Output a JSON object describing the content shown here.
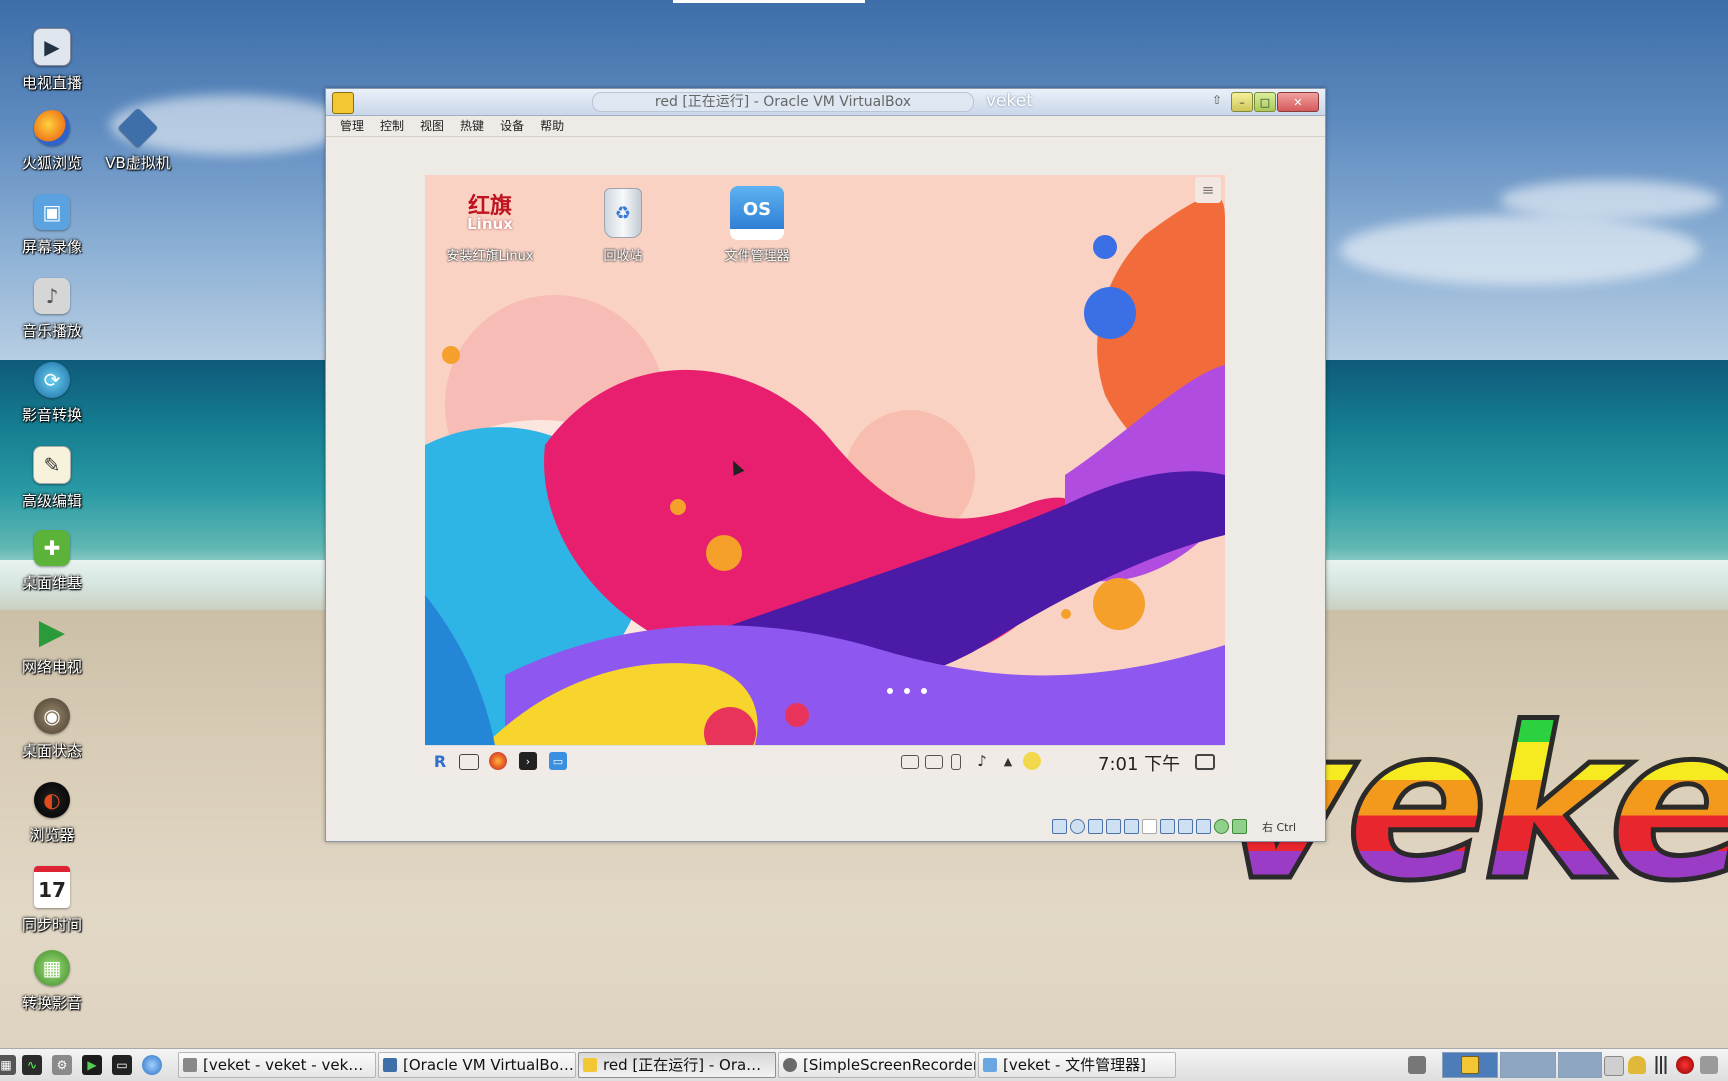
{
  "desktop": {
    "icons": [
      {
        "label": "电视直播",
        "icon": "tv-icon"
      },
      {
        "label": "火狐浏览",
        "icon": "firefox-icon"
      },
      {
        "label": "VB虚拟机",
        "icon": "virtualbox-icon"
      },
      {
        "label": "屏幕录像",
        "icon": "screen-record-icon"
      },
      {
        "label": "音乐播放",
        "icon": "speaker-icon"
      },
      {
        "label": "影音转换",
        "icon": "media-convert-icon"
      },
      {
        "label": "高级编辑",
        "icon": "notepad-icon"
      },
      {
        "label": "桌面维基",
        "icon": "wiki-icon"
      },
      {
        "label": "网络电视",
        "icon": "play-icon"
      },
      {
        "label": "桌面状态",
        "icon": "status-icon"
      },
      {
        "label": "浏览器",
        "icon": "browser-icon"
      },
      {
        "label": "同步时间",
        "icon": "calendar-icon",
        "badge": "17"
      },
      {
        "label": "转换影音",
        "icon": "film-convert-icon"
      }
    ],
    "logo_text": "veket"
  },
  "vbox": {
    "title": "red [正在运行] - Oracle VM VirtualBox",
    "wm_name": "veket",
    "menu": [
      "管理",
      "控制",
      "视图",
      "热键",
      "设备",
      "帮助"
    ],
    "host_key": "右 Ctrl"
  },
  "guest": {
    "icons": [
      {
        "label": "安装红旗Linux",
        "logo_top": "红旗",
        "logo_bottom": "Linux"
      },
      {
        "label": "回收站"
      },
      {
        "label": "文件管理器",
        "badge": "OS"
      }
    ],
    "menu_glyph": "≡",
    "clock": "7:01 下午",
    "start_glyph": "R"
  },
  "taskbar": {
    "tasks": [
      {
        "label": "[veket - veket - vek…",
        "active": false
      },
      {
        "label": "[Oracle VM VirtualBo…",
        "active": false
      },
      {
        "label": "red [正在运行] - Ora…",
        "active": true
      },
      {
        "label": "[SimpleScreenRecorder]",
        "active": false
      },
      {
        "label": "[veket - 文件管理器]",
        "active": false
      }
    ]
  },
  "colors": {
    "accent_red": "#e8262d",
    "guest_bg": "#f9d2c4",
    "taskbar_bg": "#e6e6e6"
  }
}
